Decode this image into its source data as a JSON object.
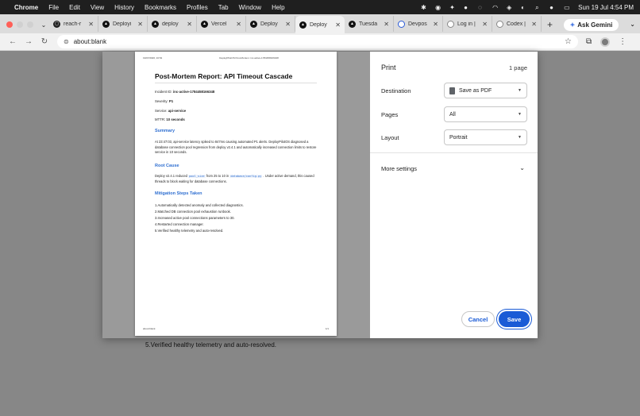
{
  "menubar": {
    "app": "Chrome",
    "items": [
      "File",
      "Edit",
      "View",
      "History",
      "Bookmarks",
      "Profiles",
      "Tab",
      "Window",
      "Help"
    ],
    "datetime": "Sun 19 Jul  4:54 PM"
  },
  "tabs": [
    {
      "label": "reach-r",
      "icon": "github-icon",
      "active": false
    },
    {
      "label": "Deployi",
      "icon": "deploy-icon",
      "active": false
    },
    {
      "label": "deploy",
      "icon": "deploy-icon",
      "active": false
    },
    {
      "label": "Vercel",
      "icon": "vercel-icon",
      "active": false
    },
    {
      "label": "Deploy",
      "icon": "deploy-icon",
      "active": false
    },
    {
      "label": "Deploy",
      "icon": "deploy-icon",
      "active": true
    },
    {
      "label": "Tuesda",
      "icon": "deploy-icon",
      "active": false
    },
    {
      "label": "Devpos",
      "icon": "devpost-icon",
      "active": false
    },
    {
      "label": "Log in |",
      "icon": "google-icon",
      "active": false
    },
    {
      "label": "Codex |",
      "icon": "codex-icon",
      "active": false
    }
  ],
  "gemini_label": "Ask Gemini",
  "address": "about:blank",
  "background_text": "5.Verified healthy telemetry and auto-resolved.",
  "preview": {
    "header_left": "19/07/2026, 16:54",
    "header_center": "DeployPilotOS Post-Mortem: inc-active-1784458166348",
    "footer_left": "about:blank",
    "footer_right": "1/1",
    "title": "Post-Mortem Report: API Timeout Cascade",
    "incident_label": "Incident ID:",
    "incident_value": "inc-active-1784458166348",
    "severity_label": "Severity:",
    "severity_value": "P1",
    "service_label": "Service:",
    "service_value": "api-service",
    "mttr_label": "MTTR:",
    "mttr_value": "10 seconds",
    "summary_heading": "Summary",
    "summary_text": "At 23:47:03, api-service latency spiked to 847ms causing automated P1 alerts. DeployPilotOS diagnosed a database connection pool regression from deploy v2.4.1 and automatically increased connection limits to restore service in 10 seconds.",
    "root_heading": "Root Cause",
    "root_a": "Deploy v2.4.1 reduced",
    "root_code1": "pool_size",
    "root_b": "from 25 to 10 in",
    "root_code2": "database/config.py",
    "root_c": ". Under active demand, this caused threads to block waiting for database connections.",
    "mitigation_heading": "Mitigation Steps Taken",
    "steps": [
      "1.Automatically detected anomaly and collected diagnostics.",
      "2.Matched DB connection pool exhaustion runbook.",
      "3.Increased active pool connections parameters to 30.",
      "4.Restarted connection manager.",
      "5.Verified healthy telemetry and auto-resolved."
    ]
  },
  "print": {
    "title": "Print",
    "page_count": "1 page",
    "destination_label": "Destination",
    "destination_value": "Save as PDF",
    "pages_label": "Pages",
    "pages_value": "All",
    "layout_label": "Layout",
    "layout_value": "Portrait",
    "more_settings": "More settings",
    "cancel": "Cancel",
    "save": "Save"
  },
  "colors": {
    "accent": "#1a5bd6",
    "heading_blue": "#2f6fd1"
  }
}
